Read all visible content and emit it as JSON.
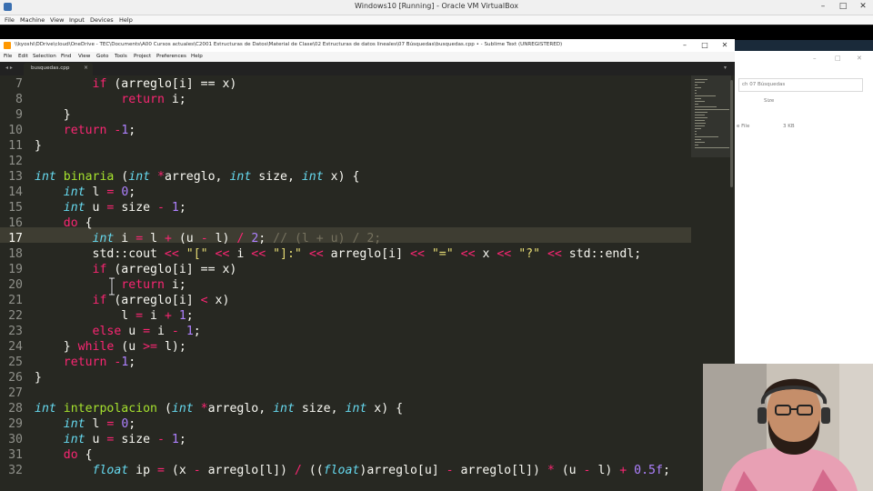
{
  "vbox": {
    "title": "Windows10 [Running] - Oracle VM VirtualBox",
    "menu": [
      "File",
      "Machine",
      "View",
      "Input",
      "Devices",
      "Help"
    ],
    "controls": {
      "minimize": "–",
      "maximize": "□",
      "close": "✕"
    }
  },
  "explorer": {
    "search_placeholder": "ch 07 Búsquedas",
    "column_size": "Size",
    "file_type": "e File",
    "file_size": "3 KB"
  },
  "sublime": {
    "title": "\\\\kyoshi\\DDrive\\cloud\\OneDrive - TEC\\Documents\\A00 Cursos actuales\\C2001 Estructuras de Datos\\Material de Clase\\02 Estructuras de datos lineales\\07 Búsquedas\\busquedas.cpp • - Sublime Text (UNREGISTERED)",
    "menu": [
      "File",
      "Edit",
      "Selection",
      "Find",
      "View",
      "Goto",
      "Tools",
      "Project",
      "Preferences",
      "Help"
    ],
    "tab": {
      "label": "busquedas.cpp",
      "close": "×"
    },
    "tab_arrows": "◂ ▸",
    "tab_dropdown": "▾",
    "controls": {
      "minimize": "–",
      "maximize": "□",
      "close": "✕"
    }
  },
  "editor": {
    "current_line": "17",
    "lines": [
      {
        "n": "7",
        "tokens": [
          [
            "",
            "        "
          ],
          [
            "kw",
            "if"
          ],
          [
            "",
            " (arreglo[i] == x)"
          ]
        ]
      },
      {
        "n": "8",
        "tokens": [
          [
            "",
            "            "
          ],
          [
            "kw",
            "return"
          ],
          [
            "",
            " i;"
          ]
        ]
      },
      {
        "n": "9",
        "tokens": [
          [
            "",
            "    }"
          ]
        ]
      },
      {
        "n": "10",
        "tokens": [
          [
            "",
            "    "
          ],
          [
            "kw",
            "return"
          ],
          [
            "",
            " "
          ],
          [
            "kw",
            "-"
          ],
          [
            "nm",
            "1"
          ],
          [
            "",
            ";"
          ]
        ]
      },
      {
        "n": "11",
        "tokens": [
          [
            "",
            "}"
          ]
        ]
      },
      {
        "n": "12",
        "tokens": [
          [
            "",
            ""
          ]
        ]
      },
      {
        "n": "13",
        "tokens": [
          [
            "ty",
            "int"
          ],
          [
            "",
            " "
          ],
          [
            "fn",
            "binaria"
          ],
          [
            "",
            " ("
          ],
          [
            "ty",
            "int"
          ],
          [
            "",
            " "
          ],
          [
            "kw",
            "*"
          ],
          [
            "",
            "arreglo, "
          ],
          [
            "ty",
            "int"
          ],
          [
            "",
            " size, "
          ],
          [
            "ty",
            "int"
          ],
          [
            "",
            " x) {"
          ]
        ]
      },
      {
        "n": "14",
        "tokens": [
          [
            "",
            "    "
          ],
          [
            "ty",
            "int"
          ],
          [
            "",
            " l "
          ],
          [
            "kw",
            "="
          ],
          [
            "",
            " "
          ],
          [
            "nm",
            "0"
          ],
          [
            "",
            ";"
          ]
        ]
      },
      {
        "n": "15",
        "tokens": [
          [
            "",
            "    "
          ],
          [
            "ty",
            "int"
          ],
          [
            "",
            " u "
          ],
          [
            "kw",
            "="
          ],
          [
            "",
            " size "
          ],
          [
            "kw",
            "-"
          ],
          [
            "",
            " "
          ],
          [
            "nm",
            "1"
          ],
          [
            "",
            ";"
          ]
        ]
      },
      {
        "n": "16",
        "tokens": [
          [
            "",
            "    "
          ],
          [
            "kw",
            "do"
          ],
          [
            "",
            " {"
          ]
        ]
      },
      {
        "n": "17",
        "tokens": [
          [
            "",
            "        "
          ],
          [
            "ty",
            "int"
          ],
          [
            "",
            " i "
          ],
          [
            "kw",
            "="
          ],
          [
            "",
            " l "
          ],
          [
            "kw",
            "+"
          ],
          [
            "",
            " (u "
          ],
          [
            "kw",
            "-"
          ],
          [
            "",
            " l) "
          ],
          [
            "kw",
            "/"
          ],
          [
            "",
            " "
          ],
          [
            "nm",
            "2"
          ],
          [
            "",
            "; "
          ],
          [
            "cm",
            "// (l + u) / 2;"
          ]
        ]
      },
      {
        "n": "18",
        "tokens": [
          [
            "",
            "        std::cout "
          ],
          [
            "kw",
            "<<"
          ],
          [
            "",
            " "
          ],
          [
            "st",
            "\"[\""
          ],
          [
            "",
            " "
          ],
          [
            "kw",
            "<<"
          ],
          [
            "",
            " i "
          ],
          [
            "kw",
            "<<"
          ],
          [
            "",
            " "
          ],
          [
            "st",
            "\"]:\""
          ],
          [
            "",
            " "
          ],
          [
            "kw",
            "<<"
          ],
          [
            "",
            " arreglo[i] "
          ],
          [
            "kw",
            "<<"
          ],
          [
            "",
            " "
          ],
          [
            "st",
            "\"=\""
          ],
          [
            "",
            " "
          ],
          [
            "kw",
            "<<"
          ],
          [
            "",
            " x "
          ],
          [
            "kw",
            "<<"
          ],
          [
            "",
            " "
          ],
          [
            "st",
            "\"?\""
          ],
          [
            "",
            " "
          ],
          [
            "kw",
            "<<"
          ],
          [
            "",
            " std::endl;"
          ]
        ]
      },
      {
        "n": "19",
        "tokens": [
          [
            "",
            "        "
          ],
          [
            "kw",
            "if"
          ],
          [
            "",
            " (arreglo[i] == x)"
          ]
        ]
      },
      {
        "n": "20",
        "tokens": [
          [
            "",
            "            "
          ],
          [
            "kw",
            "return"
          ],
          [
            "",
            " i;"
          ]
        ]
      },
      {
        "n": "21",
        "tokens": [
          [
            "",
            "        "
          ],
          [
            "kw",
            "if"
          ],
          [
            "",
            " (arreglo[i] "
          ],
          [
            "kw",
            "<"
          ],
          [
            "",
            " x)"
          ]
        ]
      },
      {
        "n": "22",
        "tokens": [
          [
            "",
            "            l "
          ],
          [
            "kw",
            "="
          ],
          [
            "",
            " i "
          ],
          [
            "kw",
            "+"
          ],
          [
            "",
            " "
          ],
          [
            "nm",
            "1"
          ],
          [
            "",
            ";"
          ]
        ]
      },
      {
        "n": "23",
        "tokens": [
          [
            "",
            "        "
          ],
          [
            "kw",
            "else"
          ],
          [
            "",
            " u "
          ],
          [
            "kw",
            "="
          ],
          [
            "",
            " i "
          ],
          [
            "kw",
            "-"
          ],
          [
            "",
            " "
          ],
          [
            "nm",
            "1"
          ],
          [
            "",
            ";"
          ]
        ]
      },
      {
        "n": "24",
        "tokens": [
          [
            "",
            "    } "
          ],
          [
            "kw",
            "while"
          ],
          [
            "",
            " (u "
          ],
          [
            "kw",
            ">="
          ],
          [
            "",
            " l);"
          ]
        ]
      },
      {
        "n": "25",
        "tokens": [
          [
            "",
            "    "
          ],
          [
            "kw",
            "return"
          ],
          [
            "",
            " "
          ],
          [
            "kw",
            "-"
          ],
          [
            "nm",
            "1"
          ],
          [
            "",
            ";"
          ]
        ]
      },
      {
        "n": "26",
        "tokens": [
          [
            "",
            "}"
          ]
        ]
      },
      {
        "n": "27",
        "tokens": [
          [
            "",
            ""
          ]
        ]
      },
      {
        "n": "28",
        "tokens": [
          [
            "ty",
            "int"
          ],
          [
            "",
            " "
          ],
          [
            "fn",
            "interpolacion"
          ],
          [
            "",
            " ("
          ],
          [
            "ty",
            "int"
          ],
          [
            "",
            " "
          ],
          [
            "kw",
            "*"
          ],
          [
            "",
            "arreglo, "
          ],
          [
            "ty",
            "int"
          ],
          [
            "",
            " size, "
          ],
          [
            "ty",
            "int"
          ],
          [
            "",
            " x) {"
          ]
        ]
      },
      {
        "n": "29",
        "tokens": [
          [
            "",
            "    "
          ],
          [
            "ty",
            "int"
          ],
          [
            "",
            " l "
          ],
          [
            "kw",
            "="
          ],
          [
            "",
            " "
          ],
          [
            "nm",
            "0"
          ],
          [
            "",
            ";"
          ]
        ]
      },
      {
        "n": "30",
        "tokens": [
          [
            "",
            "    "
          ],
          [
            "ty",
            "int"
          ],
          [
            "",
            " u "
          ],
          [
            "kw",
            "="
          ],
          [
            "",
            " size "
          ],
          [
            "kw",
            "-"
          ],
          [
            "",
            " "
          ],
          [
            "nm",
            "1"
          ],
          [
            "",
            ";"
          ]
        ]
      },
      {
        "n": "31",
        "tokens": [
          [
            "",
            "    "
          ],
          [
            "kw",
            "do"
          ],
          [
            "",
            " {"
          ]
        ]
      },
      {
        "n": "32",
        "tokens": [
          [
            "",
            "        "
          ],
          [
            "ty",
            "float"
          ],
          [
            "",
            " ip "
          ],
          [
            "kw",
            "="
          ],
          [
            "",
            " (x "
          ],
          [
            "kw",
            "-"
          ],
          [
            "",
            " arreglo[l]) "
          ],
          [
            "kw",
            "/"
          ],
          [
            "",
            " (("
          ],
          [
            "ty",
            "float"
          ],
          [
            "",
            ")arreglo[u] "
          ],
          [
            "kw",
            "-"
          ],
          [
            "",
            " arreglo[l]) "
          ],
          [
            "kw",
            "*"
          ],
          [
            "",
            " (u "
          ],
          [
            "kw",
            "-"
          ],
          [
            "",
            " l) "
          ],
          [
            "kw",
            "+"
          ],
          [
            "",
            " "
          ],
          [
            "nm",
            "0.5f"
          ],
          [
            "",
            ";"
          ]
        ]
      }
    ]
  },
  "colors": {
    "editor_bg": "#272822",
    "keyword": "#f92672",
    "type": "#66d9ef",
    "function": "#a6e22e",
    "number": "#ae81ff",
    "string": "#e6db74",
    "comment": "#75715e"
  },
  "icons": [
    "sublime-app-icon",
    "vbox-app-icon",
    "text-cursor-ibeam-icon",
    "webcam-person-icon"
  ]
}
